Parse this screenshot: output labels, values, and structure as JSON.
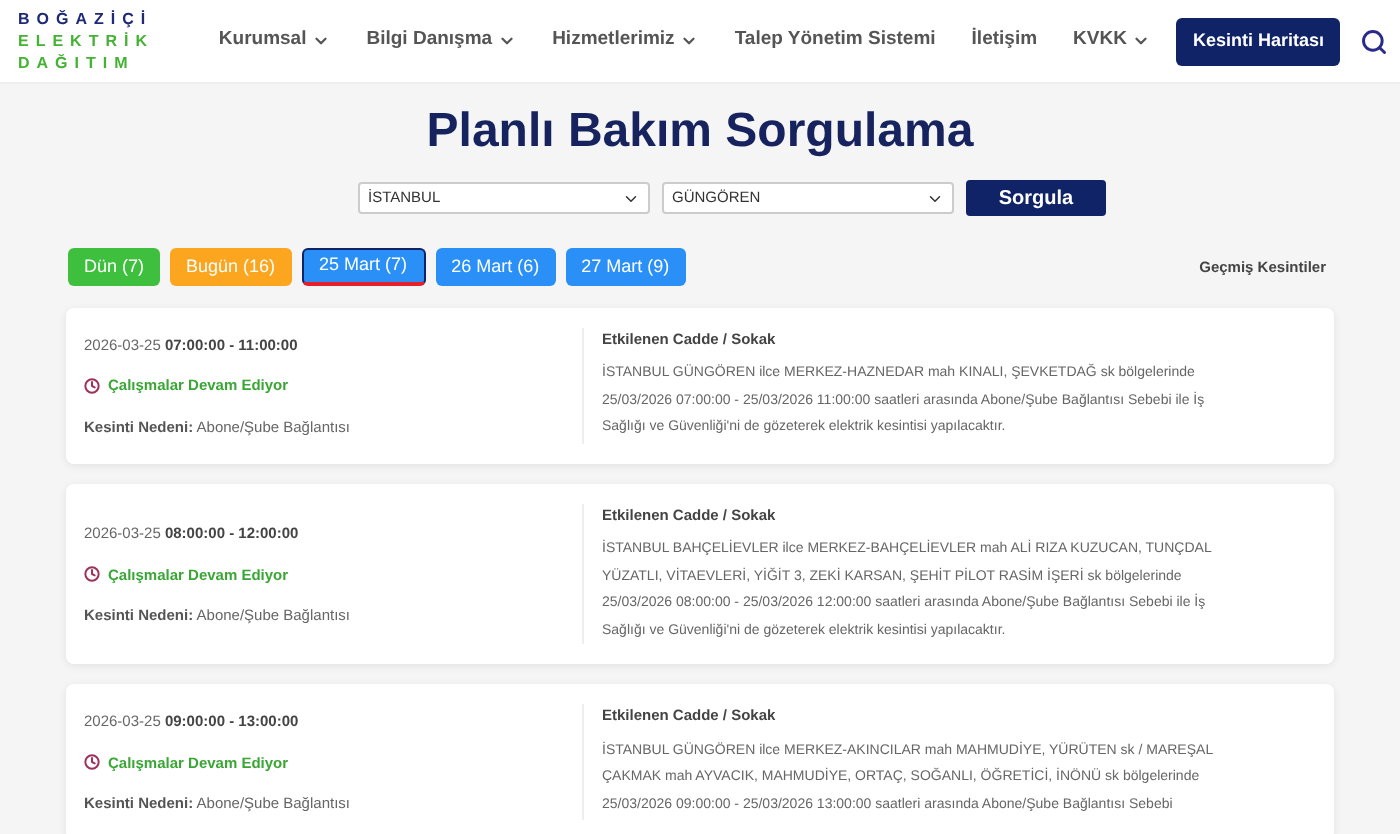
{
  "logo": [
    "BOĞAZİÇİ",
    "ELEKTRİK",
    "DAĞITIM"
  ],
  "nav": [
    {
      "label": "Kurumsal",
      "dropdown": true
    },
    {
      "label": "Bilgi Danışma",
      "dropdown": true
    },
    {
      "label": "Hizmetlerimiz",
      "dropdown": true
    },
    {
      "label": "Talep Yönetim Sistemi",
      "dropdown": false
    },
    {
      "label": "İletişim",
      "dropdown": false
    },
    {
      "label": "KVKK",
      "dropdown": true
    }
  ],
  "map_button": "Kesinti Haritası",
  "title": "Planlı Bakım Sorgulama",
  "filters": {
    "city": "İSTANBUL",
    "district": "GÜNGÖREN",
    "button": "Sorgula"
  },
  "day_tabs": [
    {
      "label": "Dün (7)",
      "color": "#3ec03e",
      "selected": false
    },
    {
      "label": "Bugün (16)",
      "color": "#fca61f",
      "selected": false
    },
    {
      "label": "25 Mart (7)",
      "color": "#2a8ff7",
      "selected": true
    },
    {
      "label": "26 Mart (6)",
      "color": "#2a8ff7",
      "selected": false
    },
    {
      "label": "27 Mart (9)",
      "color": "#2a8ff7",
      "selected": false
    }
  ],
  "past_link": "Geçmiş Kesintiler",
  "outages": [
    {
      "date": "2026-03-25",
      "time": "07:00:00 - 11:00:00",
      "status": "Çalışmalar Devam Ediyor",
      "reason_label": "Kesinti Nedeni:",
      "reason": "Abone/Şube Bağlantısı",
      "streets_label": "Etkilenen Cadde / Sokak",
      "description": "İSTANBUL GÜNGÖREN ilce MERKEZ-HAZNEDAR mah KINALI, ŞEVKETDAĞ sk bölgelerinde 25/03/2026 07:00:00 - 25/03/2026 11:00:00 saatleri arasında Abone/Şube Bağlantısı Sebebi ile İş Sağlığı ve Güvenliği'ni de gözeterek elektrik kesintisi yapılacaktır."
    },
    {
      "date": "2026-03-25",
      "time": "08:00:00 - 12:00:00",
      "status": "Çalışmalar Devam Ediyor",
      "reason_label": "Kesinti Nedeni:",
      "reason": "Abone/Şube Bağlantısı",
      "streets_label": "Etkilenen Cadde / Sokak",
      "description": "İSTANBUL BAHÇELİEVLER ilce MERKEZ-BAHÇELİEVLER mah ALİ RIZA KUZUCAN, TUNÇDAL YÜZATLI, VİTAEVLERİ, YİĞİT 3, ZEKİ KARSAN, ŞEHİT PİLOT RASİM İŞERİ sk bölgelerinde 25/03/2026 08:00:00 - 25/03/2026 12:00:00 saatleri arasında Abone/Şube Bağlantısı Sebebi ile İş Sağlığı ve Güvenliği'ni de gözeterek elektrik kesintisi yapılacaktır."
    },
    {
      "date": "2026-03-25",
      "time": "09:00:00 - 13:00:00",
      "status": "Çalışmalar Devam Ediyor",
      "reason_label": "Kesinti Nedeni:",
      "reason": "Abone/Şube Bağlantısı",
      "streets_label": "Etkilenen Cadde / Sokak",
      "description": "İSTANBUL GÜNGÖREN ilce MERKEZ-AKINCILAR mah MAHMUDİYE, YÜRÜTEN sk / MAREŞAL ÇAKMAK mah AYVACIK, MAHMUDİYE, ORTAÇ, SOĞANLI, ÖĞRETİCİ, İNÖNÜ sk bölgelerinde 25/03/2026 09:00:00 - 25/03/2026 13:00:00 saatleri arasında Abone/Şube Bağlantısı Sebebi"
    }
  ]
}
